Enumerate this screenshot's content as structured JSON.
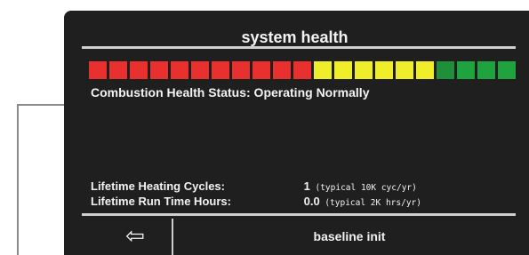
{
  "screen": {
    "title": "system health",
    "status_text": "Combustion Health Status: Operating Normally",
    "health_bar": {
      "colors": [
        "#e8312f",
        "#e8312f",
        "#e8312f",
        "#e8312f",
        "#e8312f",
        "#e8312f",
        "#e8312f",
        "#e8312f",
        "#e8312f",
        "#e8312f",
        "#e8312f",
        "#f0ee2a",
        "#f0ee2a",
        "#f0ee2a",
        "#f0ee2a",
        "#f0ee2a",
        "#f0ee2a",
        "#1f8f3a",
        "#1fa33f",
        "#1fa33f",
        "#1fa33f"
      ]
    },
    "stats": [
      {
        "label": "Lifetime Heating Cycles:",
        "value": "1",
        "note": "(typical 10K cyc/yr)"
      },
      {
        "label": "Lifetime Run Time Hours:",
        "value": "0.0",
        "note": "(typical 2K hrs/yr)"
      }
    ],
    "back_button_icon": "left-arrow-outline-icon",
    "back_button_glyph": "⇦",
    "footer_label": "baseline init"
  }
}
